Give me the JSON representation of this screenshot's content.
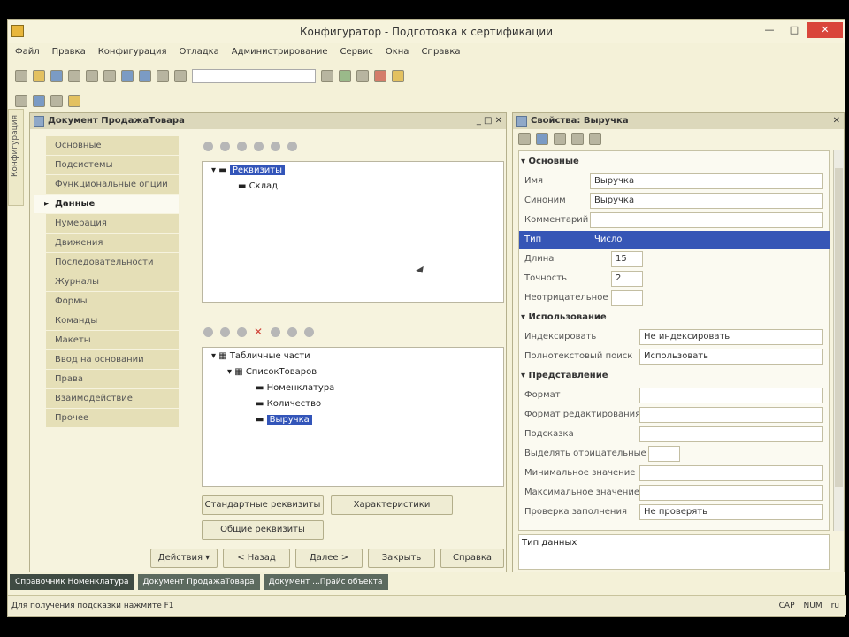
{
  "app": {
    "title": "Конфигуратор - Подготовка к сертификации",
    "window_controls": [
      "—",
      "□",
      "✕"
    ]
  },
  "menu": [
    "Файл",
    "Правка",
    "Конфигурация",
    "Отладка",
    "Администрирование",
    "Сервис",
    "Окна",
    "Справка"
  ],
  "left_panel_label": "Конфигурация",
  "object_window": {
    "title": "Документ ПродажаТовара",
    "controls": "_ □ ✕",
    "tabs": [
      "Основные",
      "Подсистемы",
      "Функциональные опции",
      "Данные",
      "Нумерация",
      "Движения",
      "Последовательности",
      "Журналы",
      "Формы",
      "Команды",
      "Макеты",
      "Ввод на основании",
      "Права",
      "Взаимодействие",
      "Прочее"
    ],
    "active_tab_index": 3,
    "attributes_tree": [
      {
        "label": "Реквизиты",
        "selected": true
      },
      {
        "label": "Склад",
        "selected": false
      }
    ],
    "tabular_tree": [
      {
        "label": "Табличные части",
        "selected": false
      },
      {
        "label": "СписокТоваров",
        "selected": false
      },
      {
        "label": "Номенклатура",
        "selected": false
      },
      {
        "label": "Количество",
        "selected": false
      },
      {
        "label": "Выручка",
        "selected": true
      }
    ],
    "pane_buttons": [
      "Стандартные реквизиты",
      "Характеристики",
      "Общие реквизиты"
    ],
    "bottom_buttons": [
      "Действия ▾",
      "< Назад",
      "Далее >",
      "Закрыть",
      "Справка"
    ]
  },
  "properties": {
    "title": "Свойства: Выручка",
    "rows": [
      {
        "kind": "group",
        "name": "Основные"
      },
      {
        "kind": "prop",
        "name": "Имя",
        "value": "Выручка"
      },
      {
        "kind": "prop",
        "name": "Синоним",
        "value": "Выручка"
      },
      {
        "kind": "prop",
        "name": "Комментарий",
        "value": ""
      },
      {
        "kind": "prop",
        "name": "Тип",
        "value": "Число",
        "selected": true
      },
      {
        "kind": "prop",
        "name": "Длина",
        "value": "15"
      },
      {
        "kind": "prop",
        "name": "Точность",
        "value": "2"
      },
      {
        "kind": "prop",
        "name": "Неотрицательное",
        "value": ""
      },
      {
        "kind": "group",
        "name": "Использование"
      },
      {
        "kind": "prop",
        "name": "Индексировать",
        "value": "Не индексировать"
      },
      {
        "kind": "prop",
        "name": "Полнотекстовый поиск",
        "value": "Использовать"
      },
      {
        "kind": "group",
        "name": "Представление"
      },
      {
        "kind": "prop",
        "name": "Формат",
        "value": ""
      },
      {
        "kind": "prop",
        "name": "Формат редактирования",
        "value": ""
      },
      {
        "kind": "prop",
        "name": "Подсказка",
        "value": ""
      },
      {
        "kind": "prop",
        "name": "Выделять отрицательные",
        "value": ""
      },
      {
        "kind": "prop",
        "name": "Минимальное значение",
        "value": ""
      },
      {
        "kind": "prop",
        "name": "Максимальное значение",
        "value": ""
      },
      {
        "kind": "prop",
        "name": "Проверка заполнения",
        "value": "Не проверять"
      }
    ],
    "description_label": "Тип данных"
  },
  "taskbar": [
    {
      "label": "Справочник Номенклатура",
      "active": true
    },
    {
      "label": "Документ ПродажаТовара",
      "active": false
    },
    {
      "label": "Документ ...Прайс объекта",
      "active": false
    }
  ],
  "status": {
    "hint": "Для получения подсказки нажмите F1",
    "indicators": [
      "CAP",
      "NUM",
      "ru"
    ]
  }
}
